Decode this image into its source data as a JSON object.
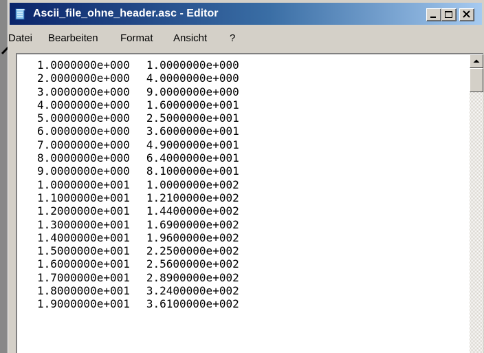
{
  "window": {
    "title": "Ascii_file_ohne_header.asc - Editor",
    "icon": "notepad-icon"
  },
  "menu": [
    {
      "label": "Datei"
    },
    {
      "label": "Bearbeiten"
    },
    {
      "label": "Format"
    },
    {
      "label": "Ansicht"
    },
    {
      "label": "?"
    }
  ],
  "content": {
    "rows": [
      {
        "x": "1.0000000e+000",
        "y": "1.0000000e+000"
      },
      {
        "x": "2.0000000e+000",
        "y": "4.0000000e+000"
      },
      {
        "x": "3.0000000e+000",
        "y": "9.0000000e+000"
      },
      {
        "x": "4.0000000e+000",
        "y": "1.6000000e+001"
      },
      {
        "x": "5.0000000e+000",
        "y": "2.5000000e+001"
      },
      {
        "x": "6.0000000e+000",
        "y": "3.6000000e+001"
      },
      {
        "x": "7.0000000e+000",
        "y": "4.9000000e+001"
      },
      {
        "x": "8.0000000e+000",
        "y": "6.4000000e+001"
      },
      {
        "x": "9.0000000e+000",
        "y": "8.1000000e+001"
      },
      {
        "x": "1.0000000e+001",
        "y": "1.0000000e+002"
      },
      {
        "x": "1.1000000e+001",
        "y": "1.2100000e+002"
      },
      {
        "x": "1.2000000e+001",
        "y": "1.4400000e+002"
      },
      {
        "x": "1.3000000e+001",
        "y": "1.6900000e+002"
      },
      {
        "x": "1.4000000e+001",
        "y": "1.9600000e+002"
      },
      {
        "x": "1.5000000e+001",
        "y": "2.2500000e+002"
      },
      {
        "x": "1.6000000e+001",
        "y": "2.5600000e+002"
      },
      {
        "x": "1.7000000e+001",
        "y": "2.8900000e+002"
      },
      {
        "x": "1.8000000e+001",
        "y": "3.2400000e+002"
      },
      {
        "x": "1.9000000e+001",
        "y": "3.6100000e+002"
      }
    ]
  },
  "colors": {
    "titlebar_start": "#0a246a",
    "titlebar_end": "#a6caf0",
    "window_face": "#d4d0c8",
    "editor_background": "#ffffff",
    "backdrop": "#888888"
  }
}
